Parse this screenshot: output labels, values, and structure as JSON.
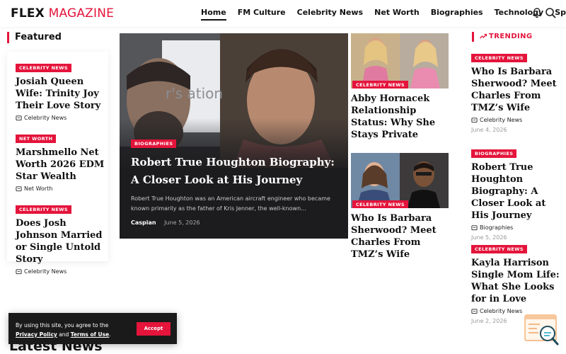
{
  "brand": {
    "part1": "FLEX",
    "part2": "MAGAZINE",
    "accent": "#e4143b"
  },
  "nav": {
    "items": [
      "Home",
      "FM Culture",
      "Celebrity News",
      "Net Worth",
      "Biographies",
      "Technology",
      "Sports"
    ],
    "icons": [
      "bell-icon",
      "search-icon"
    ]
  },
  "featured": {
    "heading": "Featured",
    "items": [
      {
        "badge": "CELEBRITY NEWS",
        "title": "Josiah Queen Wife: Trinity Joy Their Love Story",
        "category": "Celebrity News"
      },
      {
        "badge": "NET WORTH",
        "title": "Marshmello Net Worth 2026 EDM Star Wealth",
        "category": "Net Worth"
      },
      {
        "badge": "CELEBRITY NEWS",
        "title": "Does Josh Johnson Married or Single Untold Story",
        "category": "Celebrity News"
      }
    ]
  },
  "hero": {
    "badge": "BIOGRAPHIES",
    "title": "Robert True Houghton Biography: A Closer Look at His Journey",
    "excerpt": "Robert True Houghton was an American aircraft engineer who became known primarily as the father of Kris Jenner, the well-known...",
    "author": "Caspian",
    "date": "June 5, 2026",
    "image_text": "r's ation"
  },
  "middle": [
    {
      "badge": "CELEBRITY NEWS",
      "title": "Abby Hornacek Relationship Status: Why She Stays Private"
    },
    {
      "badge": "CELEBRITY NEWS",
      "title": "Who Is Barbara Sherwood? Meet Charles From TMZ’s Wife"
    }
  ],
  "trending": {
    "heading": "TRENDING",
    "items": [
      {
        "badge": "CELEBRITY NEWS",
        "title": "Who Is Barbara Sherwood? Meet Charles From TMZ’s Wife",
        "category": "Celebrity News",
        "date": "June 4, 2026"
      },
      {
        "badge": "BIOGRAPHIES",
        "title": "Robert True Houghton Biography: A Closer Look at His Journey",
        "category": "Biographies",
        "date": "June 5, 2026"
      },
      {
        "badge": "CELEBRITY NEWS",
        "title": "Kayla Harrison Single Mom Life: What She Looks for in Love",
        "category": "Celebrity News",
        "date": "June 2, 2026"
      }
    ]
  },
  "cookie": {
    "text1": "By using this site, you agree to the",
    "privacy": "Privacy Policy",
    "and": "and",
    "terms": "Terms of Use",
    "period": ".",
    "accept": "Accept"
  },
  "latest_heading": "Latest News"
}
